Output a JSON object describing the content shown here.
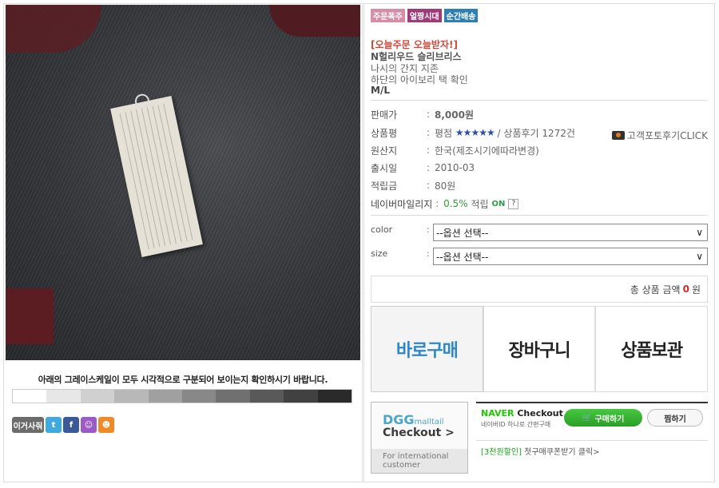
{
  "left": {
    "notice": "아래의 그레이스케일이 모두 시각적으로 구분되어 보이는지 확인하시기 바랍니다.",
    "grayscale": [
      "#ffffff",
      "#e7e7e7",
      "#d0d0d0",
      "#b8b8b8",
      "#a0a0a0",
      "#888888",
      "#707070",
      "#595959",
      "#414141",
      "#2a2a2a"
    ],
    "share_label": "이거사줘",
    "share_icons": [
      "twitter-icon",
      "facebook-icon",
      "yozm-icon",
      "me2day-icon"
    ]
  },
  "right": {
    "badges": [
      "주문폭주",
      "얼짱시대",
      "순간배송"
    ],
    "promo": "[오늘주문 오늘받자!]",
    "title": "N헐리우드 슬리브리스",
    "desc1": "나시의 간지 지존",
    "desc2": "하단의 아이보리 택 확인",
    "size": "M/L",
    "fields": {
      "price": {
        "k": "판매가",
        "v": "8,000원"
      },
      "rating": {
        "k": "상품평",
        "prefix": "평점",
        "stars": "★★★★★",
        "suffix": "/ 상품후기 1272건"
      },
      "origin": {
        "k": "원산지",
        "v": "한국(제조시기에따라변경)"
      },
      "release": {
        "k": "출시일",
        "v": "2010-03"
      },
      "points": {
        "k": "적립금",
        "v": "80원"
      },
      "naver": {
        "k": "네이버마일리지",
        "v": "0.5%",
        "suffix": "적립",
        "on": "ON",
        "q": "?"
      }
    },
    "photo_review": "고객포토후기CLICK",
    "options": [
      {
        "label": "color",
        "value": "--옵션 선택--"
      },
      {
        "label": "size",
        "value": "--옵션 선택--"
      }
    ],
    "total": {
      "prefix": "총 상품 금액",
      "amount": "0",
      "unit": "원"
    },
    "actions": [
      "바로구매",
      "장바구니",
      "상품보관"
    ],
    "dgg": {
      "line1": "DGG",
      "line1b": "malltail",
      "line2": "Checkout >",
      "line3": "For international customer"
    },
    "naver_checkout": {
      "brand": "NAVER",
      "brand2": "Checkout",
      "sub": "네이버ID 하나로 간편구매",
      "buy": "구매하기",
      "wish": "찜하기"
    },
    "coupon": {
      "tag": "[3천원할인]",
      "text": "첫구매쿠폰받기 클릭>"
    }
  }
}
